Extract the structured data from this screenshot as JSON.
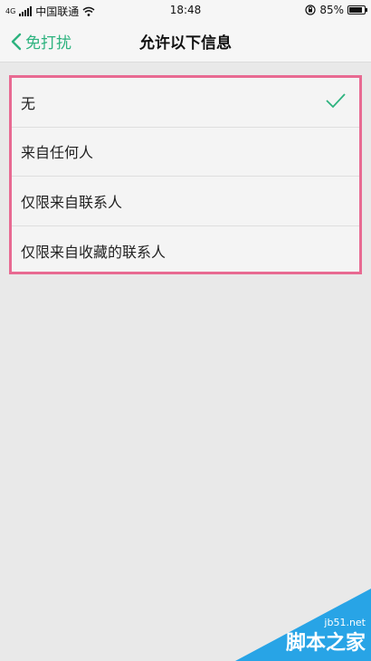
{
  "status_bar": {
    "network_type": "4G",
    "carrier": "中国联通",
    "time": "18:48",
    "battery": "85%",
    "battery_level": 0.85
  },
  "nav": {
    "back_label": "免打扰",
    "title": "允许以下信息"
  },
  "options": [
    {
      "label": "无",
      "selected": true
    },
    {
      "label": "来自任何人",
      "selected": false
    },
    {
      "label": "仅限来自联系人",
      "selected": false
    },
    {
      "label": "仅限来自收藏的联系人",
      "selected": false
    }
  ],
  "watermark": {
    "site": "jb51.net",
    "name": "脚本之家"
  },
  "colors": {
    "accent": "#2db37f",
    "highlight_border": "#e86a92",
    "background": "#e9e9e9",
    "watermark_bg": "#1ea0e6"
  },
  "icons": [
    "signal-icon",
    "wifi-icon",
    "rotation-lock-icon",
    "battery-icon",
    "chevron-left-icon",
    "checkmark-icon"
  ]
}
